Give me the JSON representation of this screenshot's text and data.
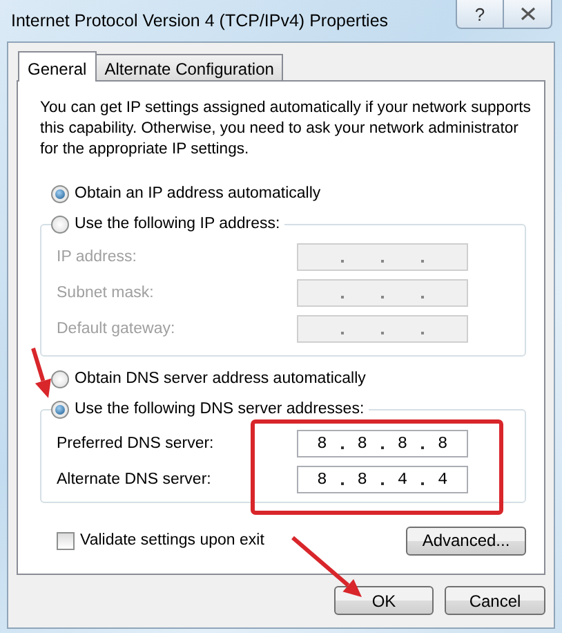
{
  "window": {
    "title": "Internet Protocol Version 4 (TCP/IPv4) Properties",
    "caption_buttons": [
      {
        "kind": "help",
        "label": "?"
      },
      {
        "kind": "close"
      }
    ]
  },
  "tabs": [
    {
      "label": "General",
      "selected": true
    },
    {
      "label": "Alternate Configuration",
      "selected": false
    }
  ],
  "description": "You can get IP settings assigned automatically if your network supports this capability. Otherwise, you need to ask your network administrator for the appropriate IP settings.",
  "ip_mode": [
    {
      "label": "Obtain an IP address automatically",
      "selected": true
    },
    {
      "label": "Use the following IP address:",
      "selected": false
    }
  ],
  "ip_fields": [
    {
      "label": "IP address:",
      "disabled": true
    },
    {
      "label": "Subnet mask:",
      "disabled": true
    },
    {
      "label": "Default gateway:",
      "disabled": true
    }
  ],
  "dns_mode": [
    {
      "label": "Obtain DNS server address automatically",
      "selected": false
    },
    {
      "label": "Use the following DNS server addresses:",
      "selected": true
    }
  ],
  "dns_fields": [
    {
      "label": "Preferred DNS server:",
      "disabled": false,
      "octets": [
        "8",
        "8",
        "8",
        "8"
      ]
    },
    {
      "label": "Alternate DNS server:",
      "disabled": false,
      "octets": [
        "8",
        "8",
        "4",
        "4"
      ]
    }
  ],
  "validate": {
    "label": "Validate settings upon exit",
    "checked": false
  },
  "advanced_button": "Advanced...",
  "buttons": [
    "OK",
    "Cancel"
  ],
  "annotations": [
    {
      "kind": "arrow"
    },
    {
      "kind": "box"
    },
    {
      "kind": "arrow"
    }
  ]
}
